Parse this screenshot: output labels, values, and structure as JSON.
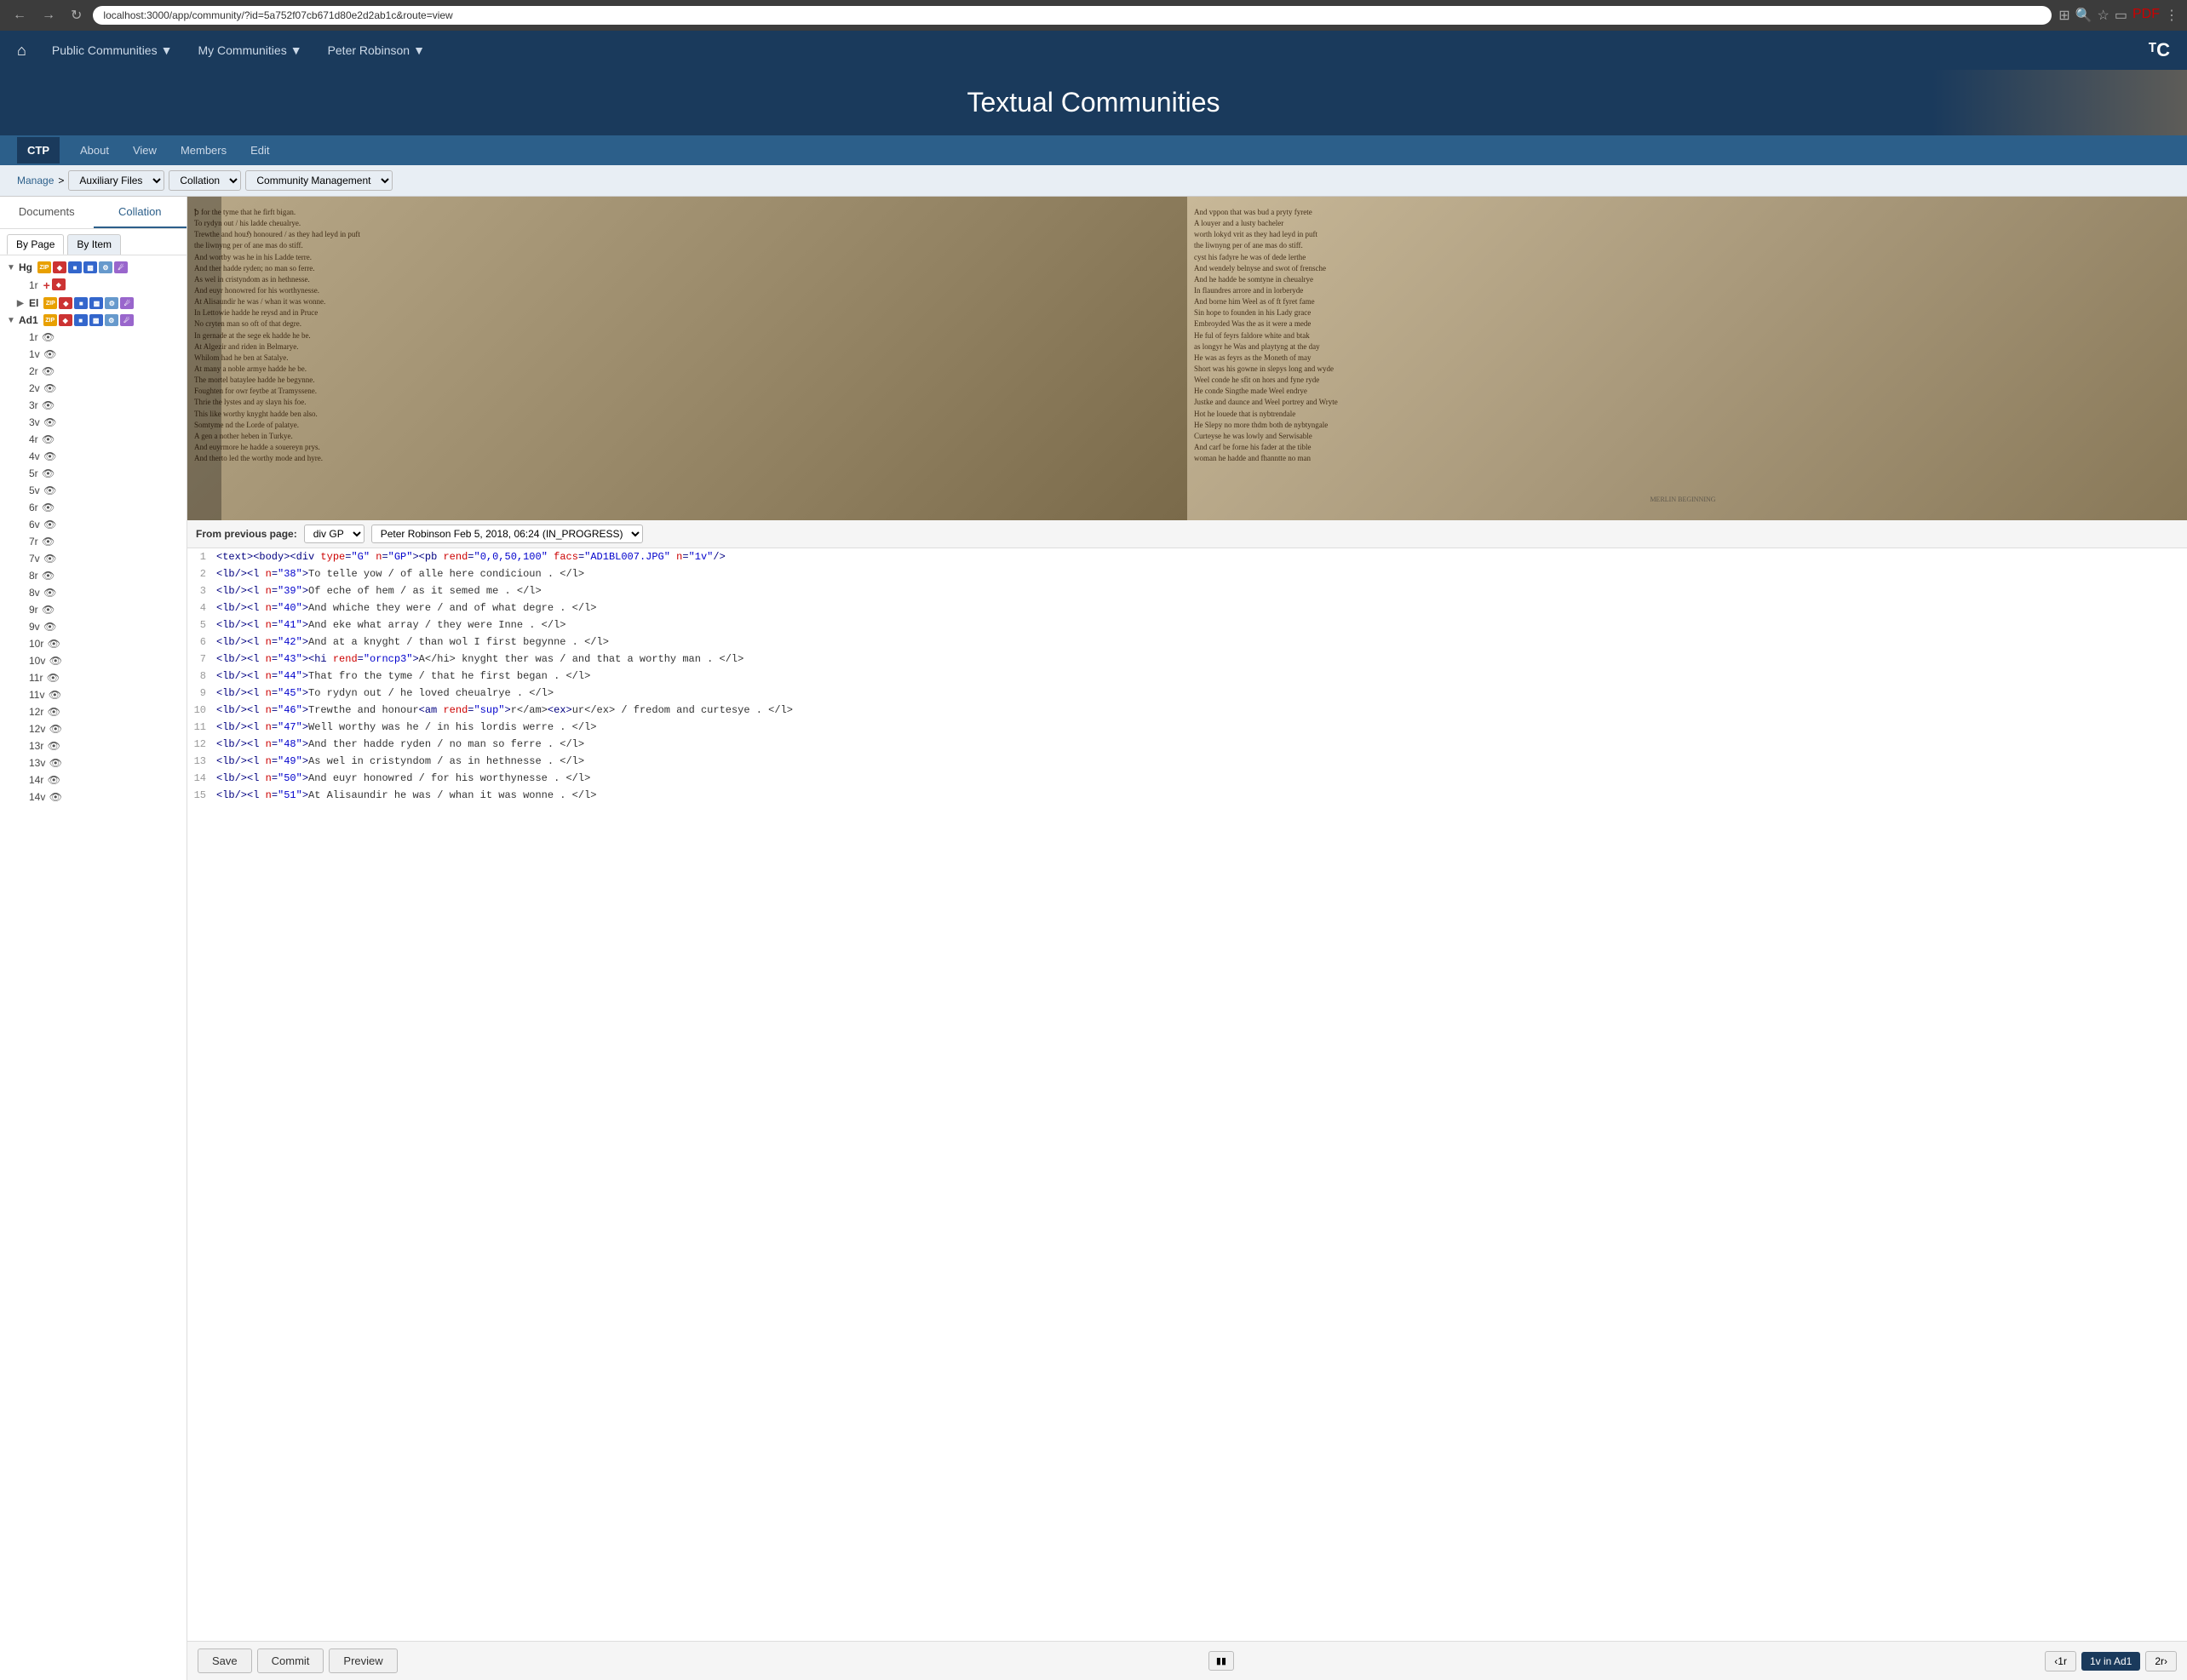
{
  "browser": {
    "url": "localhost:3000/app/community/?id=5a752f07cb671d80e2d2ab1c&route=view",
    "back_title": "Back",
    "forward_title": "Forward",
    "refresh_title": "Refresh"
  },
  "topnav": {
    "home_label": "⌂",
    "links": [
      {
        "label": "Public Communities",
        "has_dropdown": true
      },
      {
        "label": "My Communities",
        "has_dropdown": true
      },
      {
        "label": "Peter Robinson",
        "has_dropdown": true
      }
    ],
    "logo": "ᵀC"
  },
  "header": {
    "title": "Textual Communities"
  },
  "subnav": {
    "badge": "CTP",
    "links": [
      {
        "label": "About"
      },
      {
        "label": "View"
      },
      {
        "label": "Members"
      },
      {
        "label": "Edit"
      }
    ]
  },
  "breadcrumb": {
    "manage": "Manage",
    "separator": ">",
    "auxiliary_files": "Auxiliary Files",
    "collation": "Collation",
    "community_management": "Community Management"
  },
  "sidebar": {
    "tabs": [
      {
        "label": "Documents",
        "active": false
      },
      {
        "label": "Collation",
        "active": true
      }
    ],
    "view_tabs": [
      {
        "label": "By Page",
        "active": true
      },
      {
        "label": "By Item",
        "active": false
      }
    ],
    "manuscripts": [
      {
        "id": "Hg",
        "label": "Hg",
        "expanded": true,
        "has_zip": true,
        "has_red": true,
        "has_blue": true,
        "has_page": true,
        "has_gear": true,
        "has_img": true,
        "pages": [
          {
            "id": "1r",
            "label": "1r",
            "has_add": true,
            "has_red": true
          },
          {
            "id": "El",
            "label": "El",
            "expanded": false,
            "is_group": true
          }
        ]
      },
      {
        "id": "Ad1",
        "label": "Ad1",
        "expanded": true,
        "has_zip": true,
        "has_red": true,
        "has_blue": true,
        "has_page": true,
        "has_gear": true,
        "has_img": true,
        "pages": [
          {
            "label": "1r"
          },
          {
            "label": "1v"
          },
          {
            "label": "2r"
          },
          {
            "label": "2v"
          },
          {
            "label": "3r"
          },
          {
            "label": "3v"
          },
          {
            "label": "4r"
          },
          {
            "label": "4v"
          },
          {
            "label": "5r"
          },
          {
            "label": "5v"
          },
          {
            "label": "6r"
          },
          {
            "label": "6v"
          },
          {
            "label": "7r"
          },
          {
            "label": "7v"
          },
          {
            "label": "8r"
          },
          {
            "label": "8v"
          },
          {
            "label": "9r"
          },
          {
            "label": "9v"
          },
          {
            "label": "10r"
          },
          {
            "label": "10v"
          },
          {
            "label": "11r"
          },
          {
            "label": "11v"
          },
          {
            "label": "12r"
          },
          {
            "label": "12v"
          },
          {
            "label": "13r"
          },
          {
            "label": "13v"
          },
          {
            "label": "14r"
          },
          {
            "label": "14v"
          }
        ]
      }
    ]
  },
  "editor": {
    "from_previous_label": "From previous page:",
    "div_select": "div GP",
    "editor_select": "Peter Robinson Feb 5, 2018, 06:24 (IN_PROGRESS)",
    "lines": [
      {
        "num": 1,
        "html": "<span class='tag'>&lt;text&gt;&lt;body&gt;&lt;div </span><span class='attr-name'>type</span><span class='tag'>=</span><span class='attr-val'>\"G\"</span><span class='tag'> </span><span class='attr-name'>n</span><span class='tag'>=</span><span class='attr-val'>\"GP\"</span><span class='tag'>&gt;&lt;pb </span><span class='attr-name'>rend</span><span class='tag'>=</span><span class='attr-val'>\"0,0,50,100\"</span><span class='tag'> </span><span class='attr-name'>facs</span><span class='tag'>=</span><span class='attr-val'>\"AD1BL007.JPG\"</span><span class='tag'> </span><span class='attr-name'>n</span><span class='tag'>=</span><span class='attr-val'>\"1v\"</span><span class='tag'>/&gt;</span>"
      },
      {
        "num": 2,
        "html": "<span class='tag'>&lt;lb/&gt;&lt;l </span><span class='attr-name'>n</span><span class='tag'>=</span><span class='attr-val'>\"38\"</span><span class='tag'>&gt;</span><span class='text-content'>To telle yow / of alle here condicioun . &lt;/l&gt;</span>"
      },
      {
        "num": 3,
        "html": "<span class='tag'>&lt;lb/&gt;&lt;l </span><span class='attr-name'>n</span><span class='tag'>=</span><span class='attr-val'>\"39\"</span><span class='tag'>&gt;</span><span class='text-content'>Of eche of hem / as it semed me . &lt;/l&gt;</span>"
      },
      {
        "num": 4,
        "html": "<span class='tag'>&lt;lb/&gt;&lt;l </span><span class='attr-name'>n</span><span class='tag'>=</span><span class='attr-val'>\"40\"</span><span class='tag'>&gt;</span><span class='text-content'>And whiche they were / and of what degre . &lt;/l&gt;</span>"
      },
      {
        "num": 5,
        "html": "<span class='tag'>&lt;lb/&gt;&lt;l </span><span class='attr-name'>n</span><span class='tag'>=</span><span class='attr-val'>\"41\"</span><span class='tag'>&gt;</span><span class='text-content'>And eke what array / they were Inne . &lt;/l&gt;</span>"
      },
      {
        "num": 6,
        "html": "<span class='tag'>&lt;lb/&gt;&lt;l </span><span class='attr-name'>n</span><span class='tag'>=</span><span class='attr-val'>\"42\"</span><span class='tag'>&gt;</span><span class='text-content'>And at a knyght / than wol I first begynne . &lt;/l&gt;</span>"
      },
      {
        "num": 7,
        "html": "<span class='tag'>&lt;lb/&gt;&lt;l </span><span class='attr-name'>n</span><span class='tag'>=</span><span class='attr-val'>\"43\"</span><span class='tag'>&gt;&lt;hi </span><span class='attr-name'>rend</span><span class='tag'>=</span><span class='attr-val'>\"orncp3\"</span><span class='tag'>&gt;</span><span class='text-content'>A&lt;/hi&gt; knyght ther was / and that a worthy man . &lt;/l&gt;</span>"
      },
      {
        "num": 8,
        "html": "<span class='tag'>&lt;lb/&gt;&lt;l </span><span class='attr-name'>n</span><span class='tag'>=</span><span class='attr-val'>\"44\"</span><span class='tag'>&gt;</span><span class='text-content'>That fro the tyme / that he first began . &lt;/l&gt;</span>"
      },
      {
        "num": 9,
        "html": "<span class='tag'>&lt;lb/&gt;&lt;l </span><span class='attr-name'>n</span><span class='tag'>=</span><span class='attr-val'>\"45\"</span><span class='tag'>&gt;</span><span class='text-content'>To rydyn out / he loved cheualrye . &lt;/l&gt;</span>"
      },
      {
        "num": 10,
        "html": "<span class='tag'>&lt;lb/&gt;&lt;l </span><span class='attr-name'>n</span><span class='tag'>=</span><span class='attr-val'>\"46\"</span><span class='tag'>&gt;</span><span class='text-content'>Trewthe and honour</span><span class='tag'>&lt;am </span><span class='attr-name'>rend</span><span class='tag'>=</span><span class='attr-val'>\"sup\"</span><span class='tag'>&gt;</span><span class='text-content'>r&lt;/am&gt;</span><span class='tag'>&lt;ex&gt;</span><span class='text-content'>ur&lt;/ex&gt;</span><span class='text-content'> / fredom and curtesye . &lt;/l&gt;</span>"
      },
      {
        "num": 11,
        "html": "<span class='tag'>&lt;lb/&gt;&lt;l </span><span class='attr-name'>n</span><span class='tag'>=</span><span class='attr-val'>\"47\"</span><span class='tag'>&gt;</span><span class='text-content'>Well worthy was he / in his lordis werre . &lt;/l&gt;</span>"
      },
      {
        "num": 12,
        "html": "<span class='tag'>&lt;lb/&gt;&lt;l </span><span class='attr-name'>n</span><span class='tag'>=</span><span class='attr-val'>\"48\"</span><span class='tag'>&gt;</span><span class='text-content'>And ther hadde ryden / no man so ferre . &lt;/l&gt;</span>"
      },
      {
        "num": 13,
        "html": "<span class='tag'>&lt;lb/&gt;&lt;l </span><span class='attr-name'>n</span><span class='tag'>=</span><span class='attr-val'>\"49\"</span><span class='tag'>&gt;</span><span class='text-content'>As wel in cristyndom / as in hethnesse . &lt;/l&gt;</span>"
      },
      {
        "num": 14,
        "html": "<span class='tag'>&lt;lb/&gt;&lt;l </span><span class='attr-name'>n</span><span class='tag'>=</span><span class='attr-val'>\"50\"</span><span class='tag'>&gt;</span><span class='text-content'>And euyr honowred / for his worthynesse . &lt;/l&gt;</span>"
      },
      {
        "num": 15,
        "html": "<span class='tag'>&lt;lb/&gt;&lt;l </span><span class='attr-name'>n</span><span class='tag'>=</span><span class='attr-val'>\"51\"</span><span class='tag'>&gt;</span><span class='text-content'>At Alisaundir he was / whan it was wonne . &lt;/l&gt;</span>"
      }
    ]
  },
  "bottom_toolbar": {
    "save_label": "Save",
    "commit_label": "Commit",
    "preview_label": "Preview",
    "prev_page": "‹1r",
    "current_page": "1v in Ad1",
    "next_page": "2r›"
  }
}
